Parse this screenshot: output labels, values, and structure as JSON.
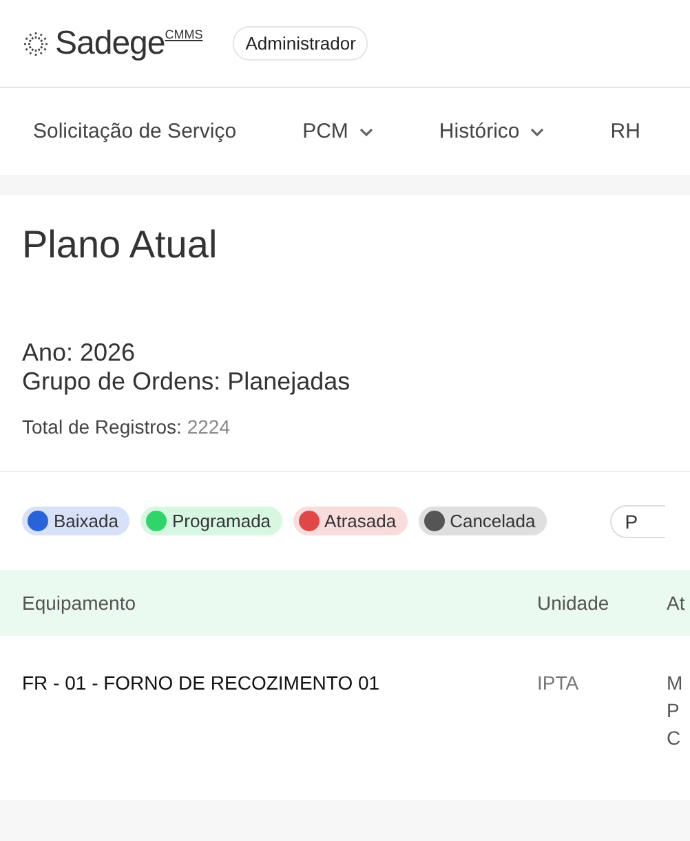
{
  "header": {
    "brand": "Sadege",
    "brand_sup": "CMMS",
    "role": "Administrador"
  },
  "nav": [
    {
      "label": "Solicitação de Serviço",
      "dropdown": false
    },
    {
      "label": "PCM",
      "dropdown": true
    },
    {
      "label": "Histórico",
      "dropdown": true
    },
    {
      "label": "RH",
      "dropdown": false
    }
  ],
  "page": {
    "title": "Plano Atual",
    "year": "Ano: 2026",
    "group": "Grupo de Ordens: Planejadas",
    "total_label": "Total de Registros:",
    "total_value": "2224"
  },
  "legend": [
    {
      "label": "Baixada",
      "color": "#2a62d9"
    },
    {
      "label": "Programada",
      "color": "#2fd46a"
    },
    {
      "label": "Atrasada",
      "color": "#e04848"
    },
    {
      "label": "Cancelada",
      "color": "#555555"
    }
  ],
  "filter": {
    "value": "P"
  },
  "table": {
    "columns": [
      "Equipamento",
      "Unidade",
      "At"
    ],
    "rows": [
      {
        "equipment": "FR - 01 - FORNO DE RECOZIMENTO 01",
        "unit": "IPTA",
        "column_3": [
          "M",
          "P",
          "C"
        ]
      }
    ]
  }
}
